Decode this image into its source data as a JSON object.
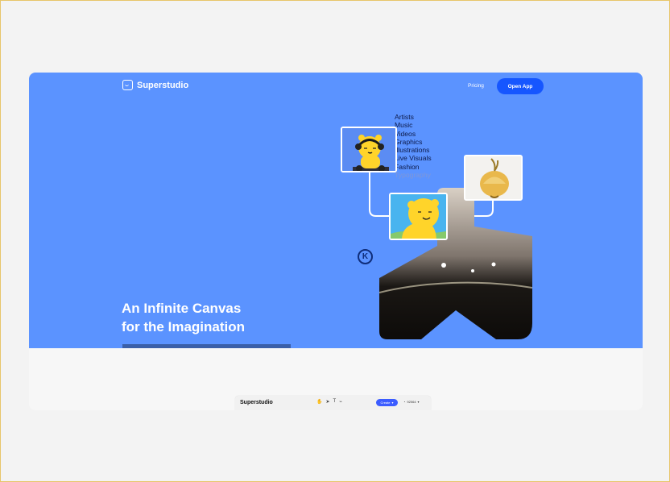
{
  "brand": {
    "name": "Superstudio"
  },
  "nav": {
    "pricing": "Pricing",
    "open_app": "Open App"
  },
  "hero": {
    "headline_line1": "An Infinite Canvas",
    "headline_line2": "for the Imagination",
    "categories": [
      "Artists",
      "Music",
      "Videos",
      "Graphics",
      "Illustrations",
      "Live Visuals",
      "Fashion",
      "Typography"
    ]
  },
  "toolbar": {
    "brand": "Superstudio",
    "tools": [
      "hand-icon",
      "select-icon",
      "text-icon",
      "link-icon"
    ],
    "create_label": "Create",
    "credits": "92064"
  },
  "colors": {
    "hero_bg": "#5b93ff",
    "button": "#1656ff",
    "dark_text": "#0d1a4a",
    "create_button": "#3b5cff"
  }
}
